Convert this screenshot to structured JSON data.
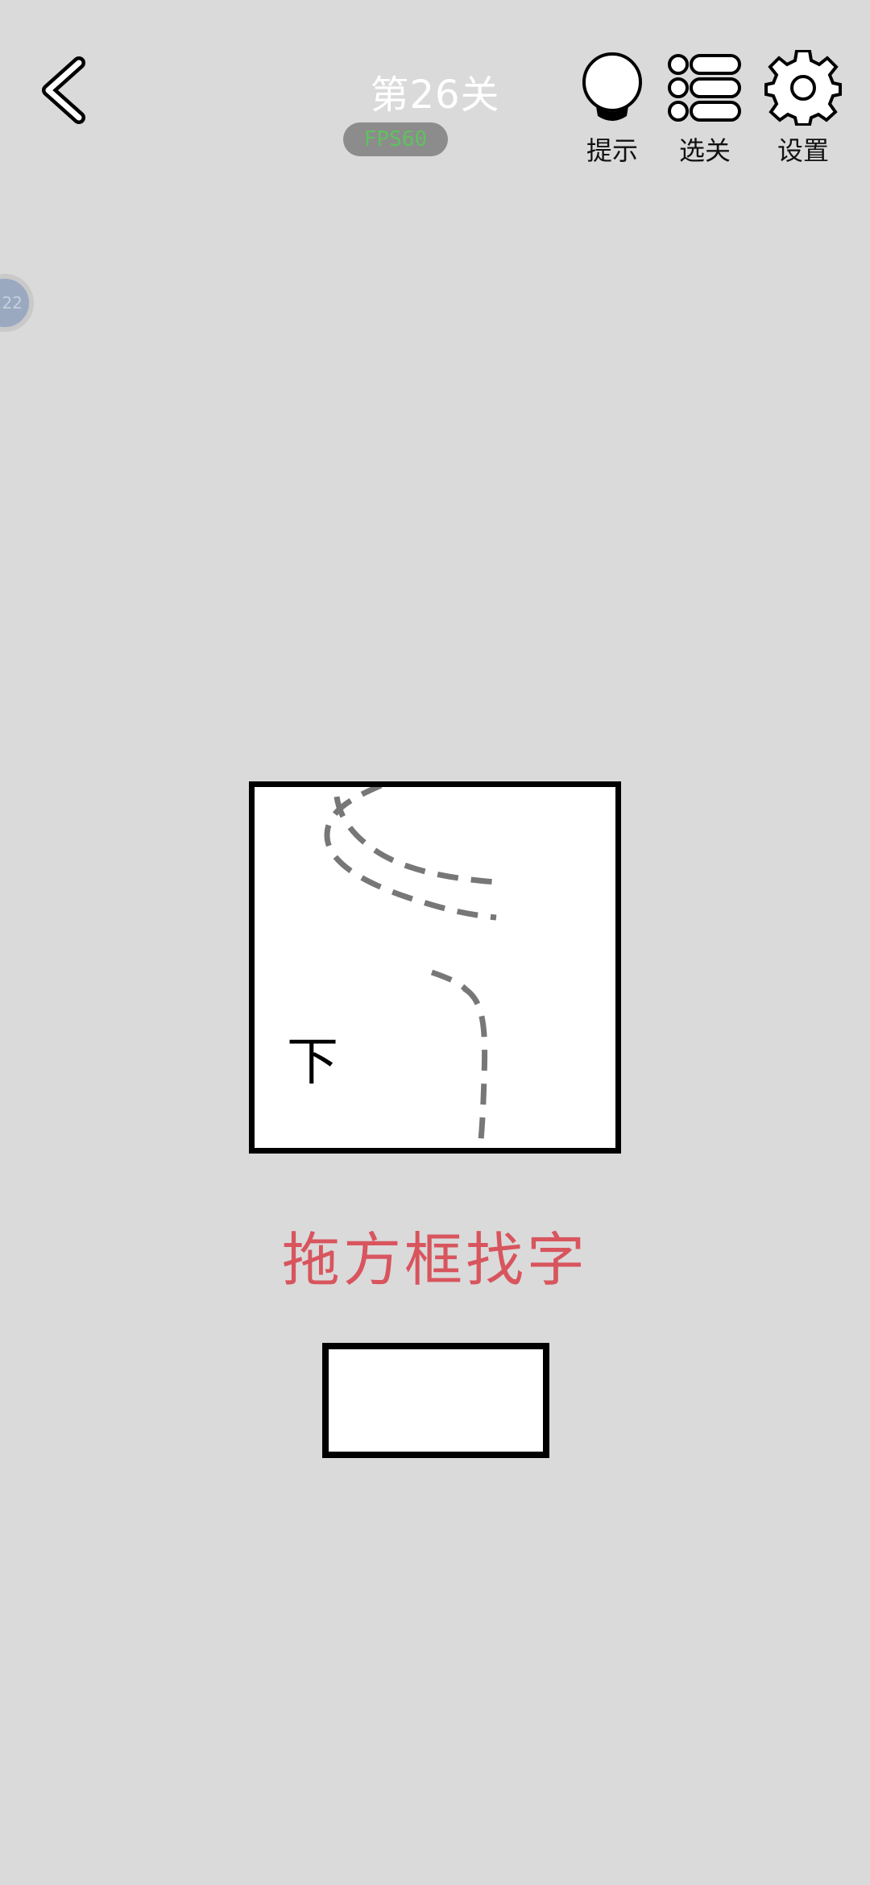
{
  "header": {
    "level_title": "第26关",
    "fps_badge": "FPS60",
    "tools": {
      "hint_label": "提示",
      "levels_label": "选关",
      "settings_label": "设置"
    }
  },
  "floating_ball": {
    "text": "22"
  },
  "puzzle": {
    "visible_char": "下"
  },
  "instruction": "拖方框找字",
  "colors": {
    "background": "#dadada",
    "instruction": "#d8555e",
    "fps_text": "#5fc15f",
    "fps_bg": "#8c8c8c",
    "dashed_line": "#777777"
  },
  "icons": {
    "back": "chevron-left-icon",
    "hint": "lightbulb-icon",
    "levels": "list-icon",
    "settings": "gear-icon"
  }
}
